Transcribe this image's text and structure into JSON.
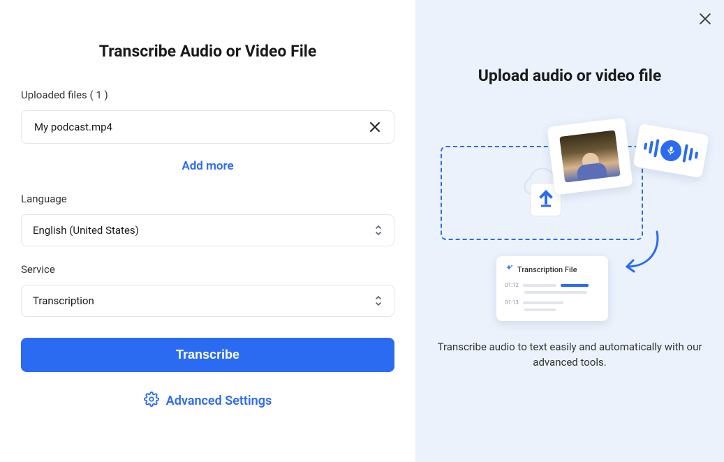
{
  "left": {
    "title": "Transcribe Audio or Video File",
    "uploaded_label": "Uploaded files ( 1 )",
    "file_name": "My podcast.mp4",
    "add_more": "Add more",
    "language_label": "Language",
    "language_value": "English (United States)",
    "service_label": "Service",
    "service_value": "Transcription",
    "transcribe_button": "Transcribe",
    "advanced_settings": "Advanced Settings"
  },
  "right": {
    "title": "Upload audio or video file",
    "description": "Transcribe audio to text easily and automatically with our advanced tools.",
    "transcription_card_title": "Transcription File",
    "time1": "01:12",
    "time2": "01:13"
  },
  "colors": {
    "accent": "#2a6bf2",
    "panel_bg": "#ebf2fc",
    "border": "#e2e5ea"
  }
}
